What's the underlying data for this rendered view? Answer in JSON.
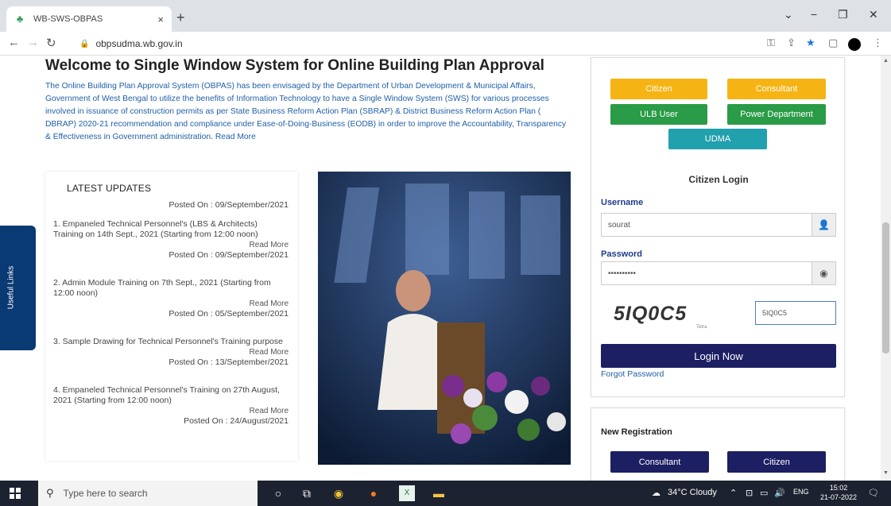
{
  "browser": {
    "tab_title": "WB-SWS-OBPAS",
    "tab_close": "×",
    "new_tab": "+",
    "url": "obpsudma.wb.gov.in",
    "window_controls": {
      "dropdown": "⌄",
      "minimize": "−",
      "maximize": "❐",
      "close": "✕"
    },
    "nav": {
      "back": "←",
      "forward": "→",
      "reload": "↻"
    }
  },
  "sidebar_tab": {
    "label": "Useful Links"
  },
  "main": {
    "title": "Welcome to Single Window System for Online Building Plan Approval",
    "intro": "The Online Building Plan Approval System (OBPAS) has been envisaged by the Department of Urban Development & Municipal Affairs, Government of West Bengal to utilize the benefits of Information Technology to have a Single Window System (SWS) for various processes involved in issuance of construction permits as per State Business Reform Action Plan (SBRAP) & District Business Reform Action Plan ( DBRAP) 2020-21 recommendation and compliance under Ease-of-Doing-Business (EODB) in order to improve the Accountability, Transparency & Effectiveness in Government administration.",
    "read_more": "Read More"
  },
  "updates": {
    "heading": "LATEST UPDATES",
    "top_posted": "Posted On : 09/September/2021",
    "items": [
      {
        "text": "1. Empaneled Technical Personnel's (LBS & Architects) Training on 14th Sept., 2021 (Starting from 12:00 noon)",
        "more": "Read More",
        "posted": "Posted On : 09/September/2021"
      },
      {
        "text": "2. Admin Module Training on 7th Sept., 2021 (Starting from 12:00 noon)",
        "more": "Read More",
        "posted": "Posted On : 05/September/2021"
      },
      {
        "text": "3. Sample Drawing for Technical Personnel's Training purpose",
        "more": "Read More",
        "posted": "Posted On : 13/September/2021"
      },
      {
        "text": "4. Empaneled Technical Personnel's Training on 27th August, 2021 (Starting from 12:00 noon)",
        "more": "Read More",
        "posted": "Posted On : 24/August/2021"
      }
    ]
  },
  "login": {
    "roles": {
      "citizen": "Citizen",
      "consultant": "Consultant",
      "ulb_user": "ULB User",
      "power_department": "Power Department",
      "udma": "UDMA"
    },
    "role_colors": {
      "citizen": "#f5b414",
      "consultant": "#f5b414",
      "ulb_user": "#2a9b46",
      "power_department": "#2a9b46",
      "udma": "#21a0ad"
    },
    "title": "Citizen Login",
    "username_label": "Username",
    "username_value": "sourat",
    "password_label": "Password",
    "password_value": "••••••••••",
    "captcha_text": "5IQ0C5",
    "captcha_sub": "Tetra",
    "captcha_value": "5IQ0C5",
    "login_button": "Login Now",
    "forgot": "Forgot Password"
  },
  "registration": {
    "heading": "New Registration",
    "consultant": "Consultant",
    "citizen": "Citizen"
  },
  "taskbar": {
    "search_placeholder": "Type here to search",
    "weather": "34°C Cloudy",
    "lang": "ENG",
    "time": "15:02",
    "date": "21-07-2022"
  }
}
